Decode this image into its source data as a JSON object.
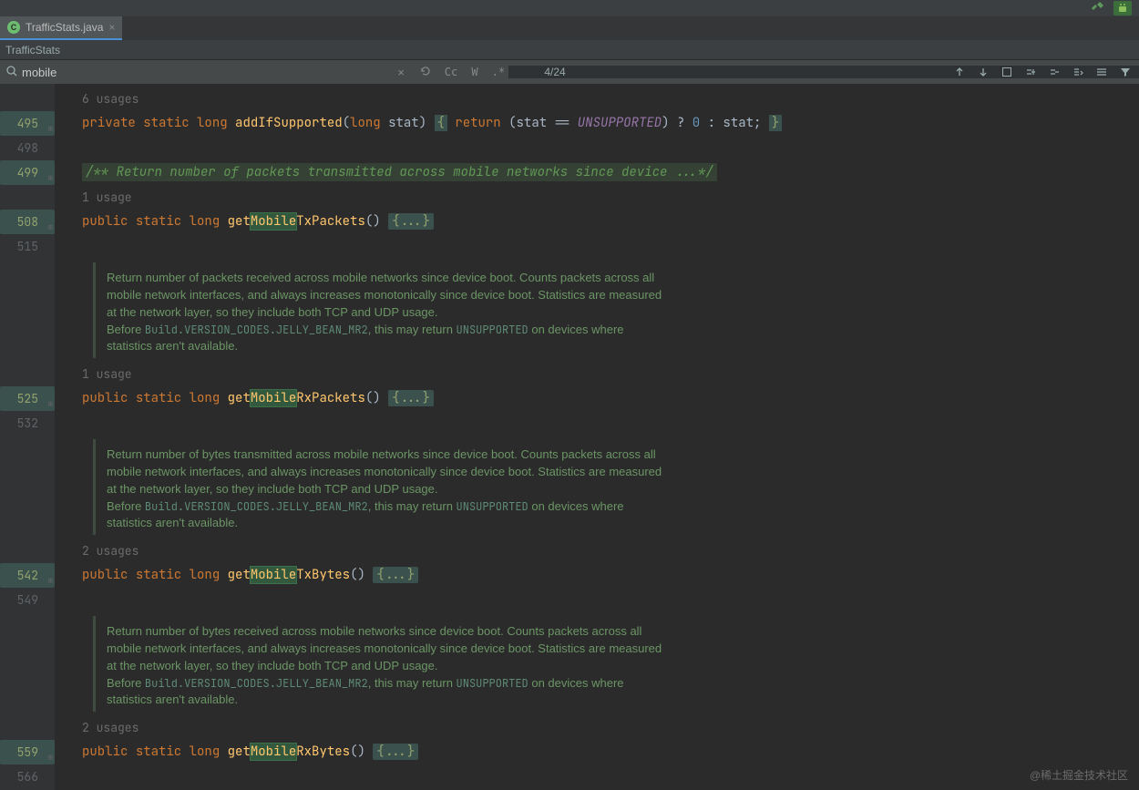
{
  "toolbar": {
    "tab_filename": "TrafficStats.java",
    "breadcrumb": "TrafficStats"
  },
  "search": {
    "query": "mobile",
    "counter": "4/24",
    "opt_cc": "Cc",
    "opt_w": "W",
    "opt_regex": ".*"
  },
  "code": {
    "usages6": "6 usages",
    "usages1a": "1 usage",
    "usages1b": "1 usage",
    "usages2a": "2 usages",
    "usages2b": "2 usages",
    "javadoc_line": "/** Return number of packets transmitted across mobile networks since device ...*/",
    "fold": "{...}",
    "kw_public": "public",
    "kw_private": "private",
    "kw_static": "static",
    "kw_long": "long",
    "kw_return": "return",
    "fn_addIfSupported": "addIfSupported",
    "fn_getMobileTxPackets_pre": "get",
    "fn_getMobileTxPackets_hl": "Mobile",
    "fn_getMobileTxPackets_post": "TxPackets",
    "fn_getMobileRxPackets_post": "RxPackets",
    "fn_getMobileTxBytes_post": "TxBytes",
    "fn_getMobileRxBytes_post": "RxBytes",
    "id_stat": "stat",
    "it_unsupported": "UNSUPPORTED",
    "num_0": "0"
  },
  "docs": {
    "rx_packets": "Return number of packets received across mobile networks since device boot. Counts packets across all mobile network interfaces, and always increases monotonically since device boot. Statistics are measured at the network layer, so they include both TCP and UDP usage.",
    "tx_bytes": "Return number of bytes transmitted across mobile networks since device boot. Counts packets across all mobile network interfaces, and always increases monotonically since device boot. Statistics are measured at the network layer, so they include both TCP and UDP usage.",
    "rx_bytes": "Return number of bytes received across mobile networks since device boot. Counts packets across all mobile network interfaces, and always increases monotonically since device boot. Statistics are measured at the network layer, so they include both TCP and UDP usage.",
    "before": "Before ",
    "ref": "Build.VERSION_CODES.JELLY_BEAN_MR2",
    "after_ref": ", this may return ",
    "unsup": "UNSUPPORTED",
    "trail": " on devices where statistics aren't available."
  },
  "gutter": {
    "l495": "495",
    "l498": "498",
    "l499": "499",
    "l508": "508",
    "l515": "515",
    "l525": "525",
    "l532": "532",
    "l542": "542",
    "l549": "549",
    "l559": "559",
    "l566": "566"
  },
  "watermark": "@稀土掘金技术社区"
}
